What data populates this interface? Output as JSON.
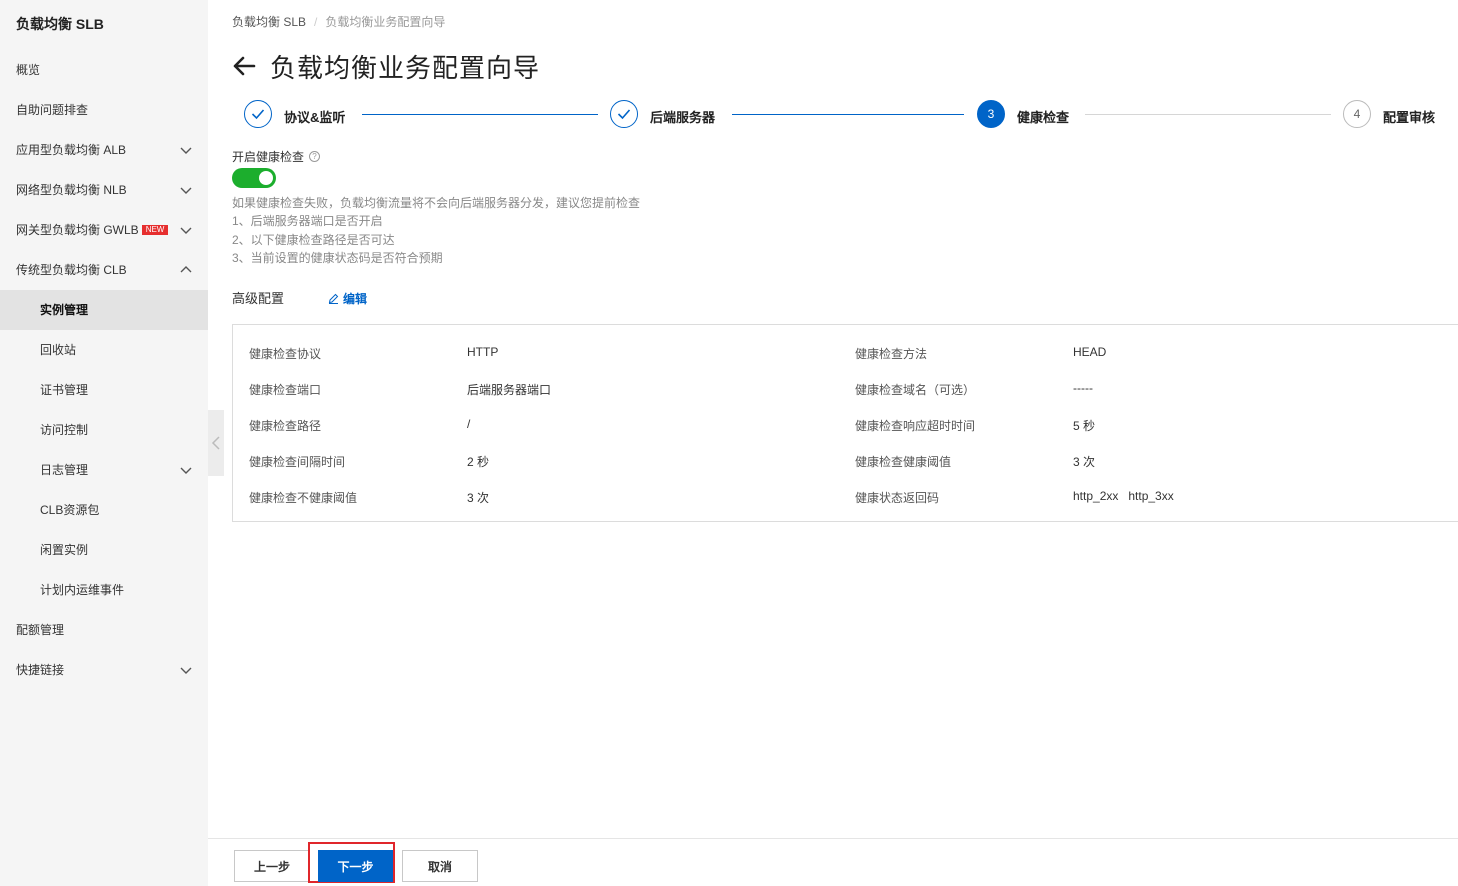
{
  "sidebar": {
    "title": "负载均衡 SLB",
    "items": [
      {
        "label": "概览"
      },
      {
        "label": "自助问题排查"
      },
      {
        "label": "应用型负载均衡 ALB"
      },
      {
        "label": "网络型负载均衡 NLB"
      },
      {
        "label": "网关型负载均衡 GWLB",
        "badge": "NEW"
      },
      {
        "label": "传统型负载均衡 CLB"
      },
      {
        "label": "实例管理"
      },
      {
        "label": "回收站"
      },
      {
        "label": "证书管理"
      },
      {
        "label": "访问控制"
      },
      {
        "label": "日志管理"
      },
      {
        "label": "CLB资源包"
      },
      {
        "label": "闲置实例"
      },
      {
        "label": "计划内运维事件"
      },
      {
        "label": "配额管理"
      },
      {
        "label": "快捷链接"
      }
    ]
  },
  "breadcrumb": {
    "root": "负载均衡 SLB",
    "separator": "/",
    "current": "负载均衡业务配置向导"
  },
  "page": {
    "title": "负载均衡业务配置向导"
  },
  "steps": [
    {
      "label": "协议&监听",
      "status": "done"
    },
    {
      "label": "后端服务器",
      "status": "done"
    },
    {
      "label": "健康检查",
      "number": "3",
      "status": "current"
    },
    {
      "label": "配置审核",
      "number": "4",
      "status": "todo"
    }
  ],
  "health_check": {
    "label": "开启健康检查",
    "help": "?",
    "enabled": true,
    "hint_lines": [
      "如果健康检查失败，负载均衡流量将不会向后端服务器分发，建议您提前检查",
      "1、后端服务器端口是否开启",
      "2、以下健康检查路径是否可达",
      "3、当前设置的健康状态码是否符合预期"
    ]
  },
  "advanced": {
    "label": "高级配置",
    "edit_label": "编辑",
    "rows": [
      {
        "k1": "健康检查协议",
        "v1": "HTTP",
        "k2": "健康检查方法",
        "v2": "HEAD"
      },
      {
        "k1": "健康检查端口",
        "v1": "后端服务器端口",
        "k2": "健康检查域名（可选）",
        "v2": "-----"
      },
      {
        "k1": "健康检查路径",
        "v1": "/",
        "k2": "健康检查响应超时时间",
        "v2": "5 秒"
      },
      {
        "k1": "健康检查间隔时间",
        "v1": "2 秒",
        "k2": "健康检查健康阈值",
        "v2": "3 次"
      },
      {
        "k1": "健康检查不健康阈值",
        "v1": "3 次",
        "k2": "健康状态返回码",
        "v2": "http_2xx   http_3xx"
      }
    ]
  },
  "footer": {
    "prev_label": "上一步",
    "next_label": "下一步",
    "cancel_label": "取消"
  },
  "colors": {
    "primary": "#0064c8",
    "toggle_on": "#1cae2d",
    "highlight": "#e0262b",
    "badge": "#e62e2e"
  }
}
